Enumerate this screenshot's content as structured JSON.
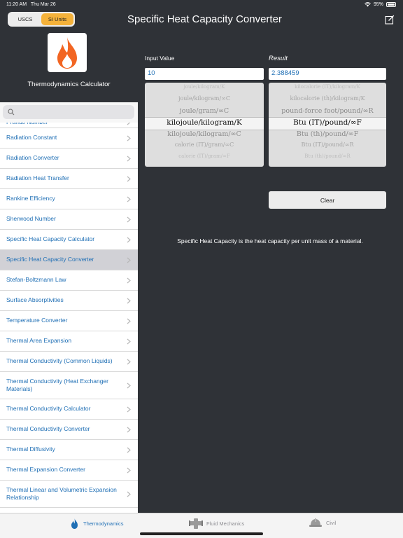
{
  "status": {
    "time": "11:20 AM",
    "date": "Thu Mar 26",
    "battery": "95%",
    "battery_level": 0.95
  },
  "nav": {
    "segments": [
      {
        "label": "USCS",
        "active": false
      },
      {
        "label": "SI Units",
        "active": true
      }
    ],
    "title": "Specific Heat Capacity Converter",
    "edit_icon": "edit-icon"
  },
  "sidebar": {
    "logo_icon": "flame-icon",
    "title": "Thermodynamics Calculator",
    "search": {
      "placeholder": "",
      "value": ""
    },
    "items": [
      {
        "label": "Prandtl Number"
      },
      {
        "label": "Radiation Constant"
      },
      {
        "label": "Radiation Converter"
      },
      {
        "label": "Radiation Heat Transfer"
      },
      {
        "label": "Rankine Efficiency"
      },
      {
        "label": "Sherwood Number"
      },
      {
        "label": "Specific Heat Capacity Calculator"
      },
      {
        "label": "Specific Heat Capacity Converter",
        "selected": true
      },
      {
        "label": "Stefan-Boltzmann Law"
      },
      {
        "label": "Surface Absorptivities"
      },
      {
        "label": "Temperature Converter"
      },
      {
        "label": "Thermal Area Expansion"
      },
      {
        "label": "Thermal Conductivity (Common Liquids)"
      },
      {
        "label": "Thermal Conductivity (Heat Exchanger Materials)"
      },
      {
        "label": "Thermal Conductivity Calculator"
      },
      {
        "label": "Thermal Conductivity Converter"
      },
      {
        "label": "Thermal Diffusivity"
      },
      {
        "label": "Thermal Expansion Converter"
      },
      {
        "label": "Thermal Linear and Volumetric Expansion Relationship"
      }
    ]
  },
  "main": {
    "input_label": "Input Value",
    "input_value": "10",
    "result_label": "Result",
    "result_value": "2.388459",
    "input_units": [
      "joule/kilogram/K",
      "joule/kilogram/∞C",
      "joule/gram/∞C",
      "kilojoule/kilogram/K",
      "kilojoule/kilogram/∞C",
      "calorie (IT)/gram/∞C",
      "calorie (IT)/gram/∞F"
    ],
    "input_selected": "kilojoule/kilogram/K",
    "result_units": [
      "kilocalorie (IT)/kilogram/K",
      "kilocalorie (th)/kilogram/K",
      "pound-force foot/pound/∞R",
      "Btu (IT)/pound/∞F",
      "Btu (th)/pound/∞F",
      "Btu (IT)/pound/∞R",
      "Btu (th)/pound/∞R"
    ],
    "result_selected": "Btu (IT)/pound/∞F",
    "clear_label": "Clear",
    "description": "Specific Heat Capacity is the heat capacity per unit mass of a material."
  },
  "tabbar": {
    "tabs": [
      {
        "label": "Thermodynamics",
        "icon": "flame-icon",
        "active": true
      },
      {
        "label": "Fluid Mechanics",
        "icon": "pipes-icon",
        "active": false
      },
      {
        "label": "Civil",
        "icon": "hardhat-icon",
        "active": false
      }
    ]
  },
  "colors": {
    "accent": "#1f6fb5",
    "segment_active": "#f5b23a",
    "background": "#2f3237",
    "flame": "#f26522"
  }
}
